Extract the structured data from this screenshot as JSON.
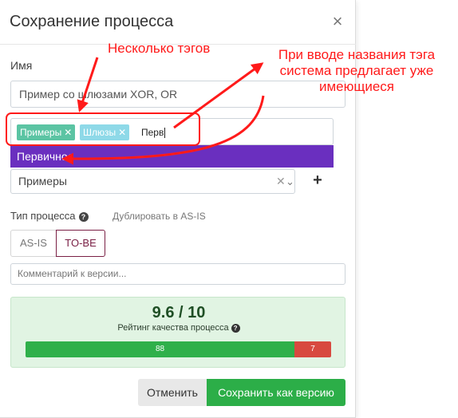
{
  "modal": {
    "title": "Сохранение процесса",
    "close_glyph": "×"
  },
  "name_field": {
    "label": "Имя",
    "value": "Пример со шлюзами XOR, OR"
  },
  "tags": {
    "items": [
      {
        "label": "Примеры",
        "remove_glyph": "✕"
      },
      {
        "label": "Шлюзы",
        "remove_glyph": "✕"
      }
    ],
    "input_value": "Перв"
  },
  "suggestion": {
    "label": "Первичное"
  },
  "folder_select": {
    "value": "Примеры",
    "clear_glyph": "✕",
    "chevron_glyph": "⌄",
    "add_glyph": "+"
  },
  "process_type": {
    "label": "Тип процесса",
    "help_glyph": "?",
    "duplicate_link": "Дублировать в AS-IS",
    "options": [
      {
        "label": "AS-IS",
        "selected": false
      },
      {
        "label": "TO-BE",
        "selected": true
      }
    ]
  },
  "comment": {
    "placeholder": "Комментарий к версии..."
  },
  "rating": {
    "score": "9.6 / 10",
    "label": "Рейтинг качества процесса",
    "help_glyph": "?",
    "good_value": "88",
    "bad_value": "7",
    "good_share": 0.88
  },
  "actions": {
    "cancel": "Отменить",
    "save": "Сохранить как версию"
  },
  "annotations": {
    "multi_tags": "Несколько тэгов",
    "suggest_line1": "При вводе названия тэга",
    "suggest_line2": "система предлагает уже",
    "suggest_line3": "имеющиеся"
  },
  "colors": {
    "accent_purple": "#6a2fbf",
    "save_green": "#2cae48",
    "tag_green": "#5bc4a3",
    "tag_cyan": "#8ed9e8",
    "annotation_red": "#ff1a1a"
  }
}
